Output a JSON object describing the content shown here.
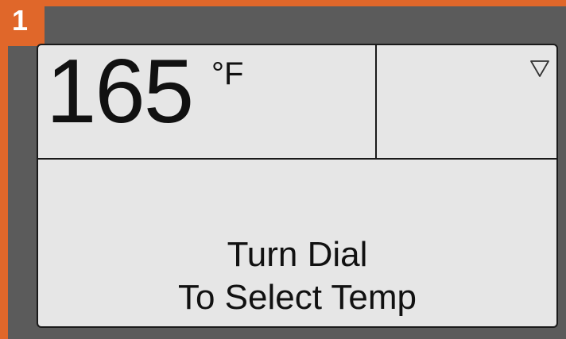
{
  "step": {
    "number": "1",
    "badge_color": "#e0672a"
  },
  "display": {
    "temperature": "165",
    "unit": "°F",
    "indicator_icon": "triangle-down-outline-icon",
    "message_line1": "Turn Dial",
    "message_line2": "To Select Temp"
  },
  "colors": {
    "frame_background": "#5b5b5b",
    "screen_background": "#e6e6e6",
    "text": "#111111"
  }
}
